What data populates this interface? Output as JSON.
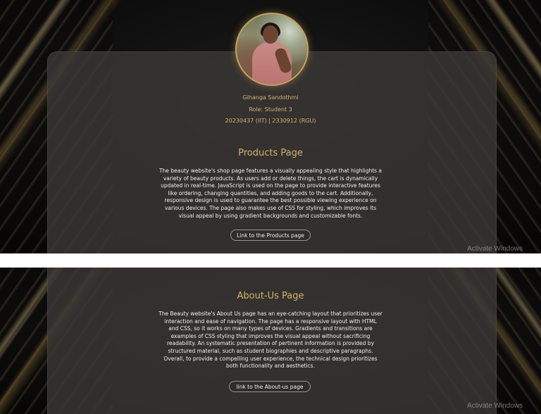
{
  "profile": {
    "name": "Gihanga Sandothmi",
    "role": "Role: Student 3",
    "ids": "20230437 (IIT) | 2330912 (RGU)"
  },
  "products": {
    "title": "Products Page",
    "description": "The beauty website's shop page features a visually appealing style that highlights a variety of beauty products. As users add or delete things, the cart is dynamically updated in real-time. JavaScript is used on the page to provide interactive features like ordering, changing quantities, and adding goods to the cart. Additionally, responsive design is used to guarantee the best possible viewing experience on various devices. The page also makes use of CSS for styling, which improves its visual appeal by using gradient backgrounds and customizable fonts.",
    "link_label": "Link to the Products page"
  },
  "about": {
    "title": "About-Us Page",
    "description": "The Beauty website's About Us page has an eye-catching layout that prioritizes user interaction and ease of navigation. The page has a responsive layout with HTML and CSS, so it works on many types of devices. Gradients and transitions are examples of CSS styling that improves the visual appeal without sacrificing readability. An systematic presentation of pertinent information is provided by structured material, such as student biographies and descriptive paragraphs. Overall, to provide a compelling user experience, the technical design prioritizes both functionality and aesthetics.",
    "link_label": "link to the About-us page"
  },
  "os_watermark": "Activate Windows",
  "colors": {
    "accent": "#d7b26a",
    "card": "#3a3836",
    "background": "#0d0d0d"
  }
}
